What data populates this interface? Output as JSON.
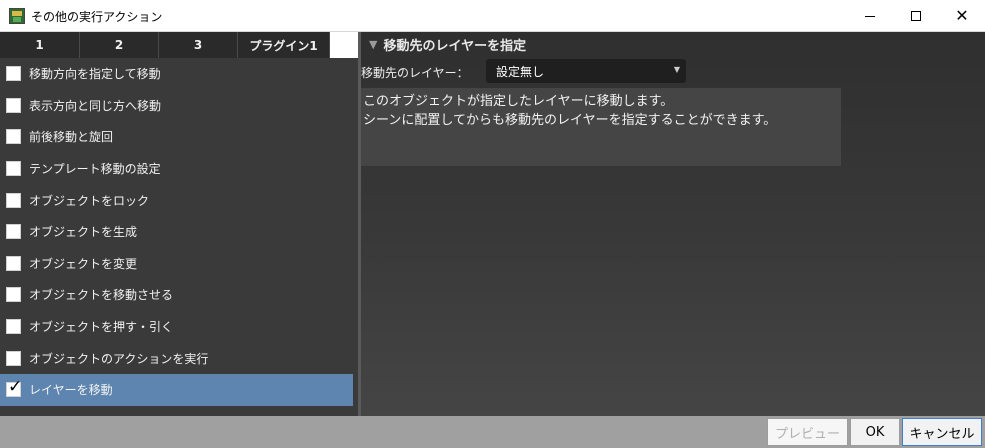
{
  "window": {
    "title": "その他の実行アクション"
  },
  "tabs": [
    {
      "label": "1"
    },
    {
      "label": "2"
    },
    {
      "label": "3"
    },
    {
      "label": "プラグイン1"
    }
  ],
  "actions": [
    {
      "label": "移動方向を指定して移動",
      "checked": false
    },
    {
      "label": "表示方向と同じ方へ移動",
      "checked": false
    },
    {
      "label": "前後移動と旋回",
      "checked": false
    },
    {
      "label": "テンプレート移動の設定",
      "checked": false
    },
    {
      "label": "オブジェクトをロック",
      "checked": false
    },
    {
      "label": "オブジェクトを生成",
      "checked": false
    },
    {
      "label": "オブジェクトを変更",
      "checked": false
    },
    {
      "label": "オブジェクトを移動させる",
      "checked": false
    },
    {
      "label": "オブジェクトを押す・引く",
      "checked": false
    },
    {
      "label": "オブジェクトのアクションを実行",
      "checked": false
    },
    {
      "label": "レイヤーを移動",
      "checked": true,
      "selected": true
    }
  ],
  "detail": {
    "section_title": "移動先のレイヤーを指定",
    "layer_label": "移動先のレイヤー：",
    "layer_value": "設定無し",
    "description_line1": "このオブジェクトが指定したレイヤーに移動します。",
    "description_line2": "シーンに配置してからも移動先のレイヤーを指定することができます。"
  },
  "buttons": {
    "preview": "プレビュー",
    "ok": "OK",
    "cancel": "キャンセル"
  },
  "colors": {
    "selected_row": "#5d85b0",
    "panel_bg": "#3a3a3a",
    "bottom_bar": "#a0a0a0"
  }
}
